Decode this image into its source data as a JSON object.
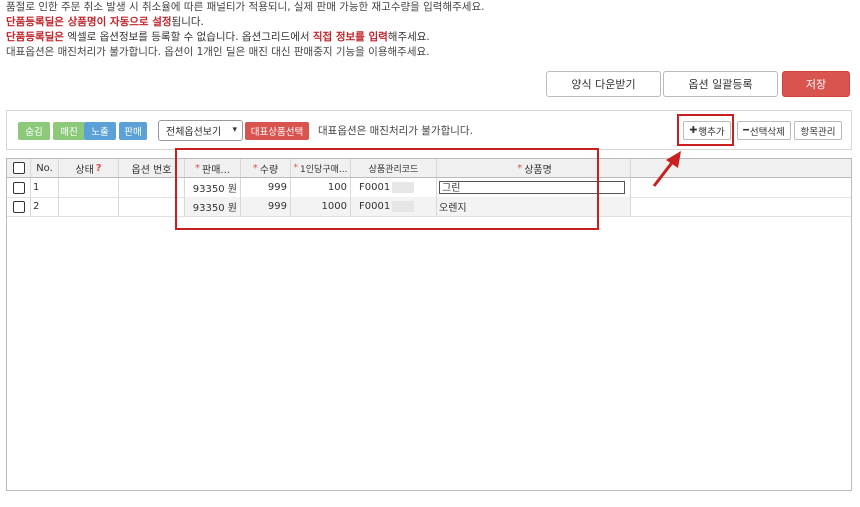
{
  "notices": {
    "line1": "품절로 인한 주문 취소 발생 시 취소율에 따른 패널티가 적용되니, 실제 판매 가능한 재고수량을 입력해주세요.",
    "line2_bold": "단품등록딜은 상품명이 자동으로 설정",
    "line2_rest": "됩니다.",
    "line3_bold": "단품등록딜은",
    "line3_mid": " 엑셀로 옵션정보를 등록할 수 없습니다. 옵션그리드에서 ",
    "line3_bold2": "직접 정보를 입력",
    "line3_end": "해주세요.",
    "line4": "대표옵션은 매진처리가 불가합니다. 옵션이 1개인 딜은 매진 대신 판매중지 기능을 이용해주세요."
  },
  "top_buttons": {
    "form_download": "양식 다운받기",
    "bulk_register": "옵션 일괄등록",
    "save": "저장"
  },
  "toolbar": {
    "hide": "숨김",
    "soldout": "매진",
    "show": "노출",
    "sell": "판매",
    "view_select": "전체옵션보기",
    "rep_product": "대표상품선택",
    "rep_note": "대표옵션은 매진처리가 불가합니다.",
    "add_row": "행추가",
    "delete_selected": "선택삭제",
    "manage_columns": "항목관리"
  },
  "grid": {
    "headers": {
      "no": "No.",
      "status": "상태",
      "status_help": "?",
      "option_no": "옵션 번호",
      "price": "판매...",
      "qty": "수량",
      "limit": "1인당구매...",
      "code": "상품관리코드",
      "name": "상품명"
    },
    "rows": [
      {
        "no": "1",
        "price": "93350 원",
        "qty": "999",
        "limit": "100",
        "code": "F0001",
        "name": "그린"
      },
      {
        "no": "2",
        "price": "93350 원",
        "qty": "999",
        "limit": "1000",
        "code": "F0001",
        "name": "오렌지"
      }
    ]
  },
  "colors": {
    "save_bg": "#d9534f",
    "hide_bg": "#8cc97a",
    "show_bg": "#5ba0d6",
    "highlight": "#c91f1f"
  }
}
